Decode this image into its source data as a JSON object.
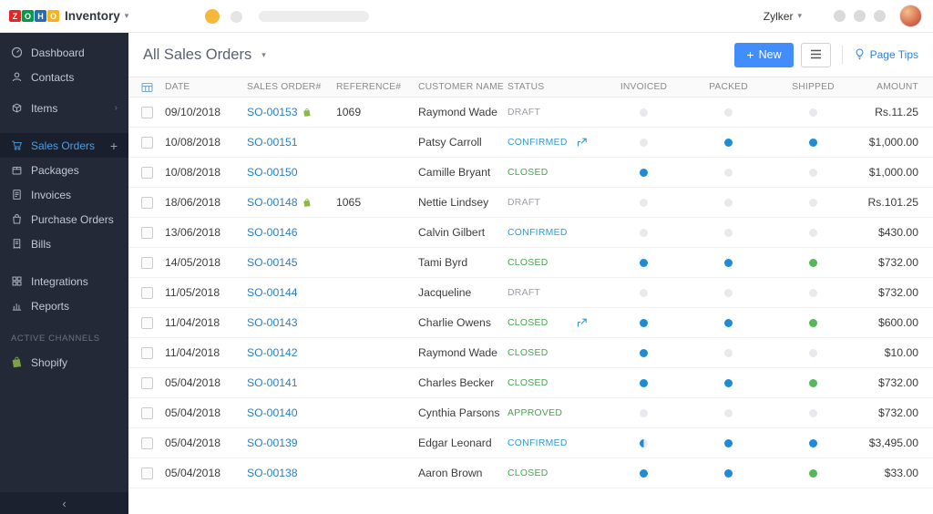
{
  "topbar": {
    "logo_letters": [
      "Z",
      "O",
      "H",
      "O"
    ],
    "product": "Inventory",
    "org_name": "Zylker"
  },
  "sidebar": {
    "items": [
      {
        "label": "Dashboard"
      },
      {
        "label": "Contacts"
      },
      {
        "label": "Items"
      },
      {
        "label": "Sales Orders",
        "active": true
      },
      {
        "label": "Packages"
      },
      {
        "label": "Invoices"
      },
      {
        "label": "Purchase Orders"
      },
      {
        "label": "Bills"
      },
      {
        "label": "Integrations"
      },
      {
        "label": "Reports"
      }
    ],
    "section_label": "ACTIVE CHANNELS",
    "channels": [
      {
        "label": "Shopify"
      }
    ]
  },
  "content": {
    "title": "All Sales Orders",
    "new_button_label": "New",
    "page_tips_label": "Page Tips"
  },
  "table": {
    "columns": [
      "DATE",
      "SALES ORDER#",
      "REFERENCE#",
      "CUSTOMER NAME",
      "STATUS",
      "INVOICED",
      "PACKED",
      "SHIPPED",
      "AMOUNT"
    ],
    "rows": [
      {
        "date": "09/10/2018",
        "order": "SO-00153",
        "shopify": true,
        "reference": "1069",
        "customer": "Raymond Wade",
        "status": "DRAFT",
        "status_type": "draft",
        "linked": false,
        "invoiced": "gray",
        "packed": "gray",
        "shipped": "gray",
        "amount": "Rs.11.25"
      },
      {
        "date": "10/08/2018",
        "order": "SO-00151",
        "shopify": false,
        "reference": "",
        "customer": "Patsy Carroll",
        "status": "CONFIRMED",
        "status_type": "confirmed",
        "linked": true,
        "invoiced": "gray",
        "packed": "blue",
        "shipped": "blue",
        "amount": "$1,000.00"
      },
      {
        "date": "10/08/2018",
        "order": "SO-00150",
        "shopify": false,
        "reference": "",
        "customer": "Camille Bryant",
        "status": "CLOSED",
        "status_type": "closed",
        "linked": false,
        "invoiced": "blue",
        "packed": "gray",
        "shipped": "gray",
        "amount": "$1,000.00"
      },
      {
        "date": "18/06/2018",
        "order": "SO-00148",
        "shopify": true,
        "reference": "1065",
        "customer": "Nettie Lindsey",
        "status": "DRAFT",
        "status_type": "draft",
        "linked": false,
        "invoiced": "gray",
        "packed": "gray",
        "shipped": "gray",
        "amount": "Rs.101.25"
      },
      {
        "date": "13/06/2018",
        "order": "SO-00146",
        "shopify": false,
        "reference": "",
        "customer": "Calvin Gilbert",
        "status": "CONFIRMED",
        "status_type": "confirmed",
        "linked": false,
        "invoiced": "gray",
        "packed": "gray",
        "shipped": "gray",
        "amount": "$430.00"
      },
      {
        "date": "14/05/2018",
        "order": "SO-00145",
        "shopify": false,
        "reference": "",
        "customer": "Tami Byrd",
        "status": "CLOSED",
        "status_type": "closed",
        "linked": false,
        "invoiced": "blue",
        "packed": "blue",
        "shipped": "green",
        "amount": "$732.00"
      },
      {
        "date": "11/05/2018",
        "order": "SO-00144",
        "shopify": false,
        "reference": "",
        "customer": "Jacqueline",
        "status": "DRAFT",
        "status_type": "draft",
        "linked": false,
        "invoiced": "gray",
        "packed": "gray",
        "shipped": "gray",
        "amount": "$732.00"
      },
      {
        "date": "11/04/2018",
        "order": "SO-00143",
        "shopify": false,
        "reference": "",
        "customer": "Charlie Owens",
        "status": "CLOSED",
        "status_type": "closed",
        "linked": true,
        "invoiced": "blue",
        "packed": "blue",
        "shipped": "green",
        "amount": "$600.00"
      },
      {
        "date": "11/04/2018",
        "order": "SO-00142",
        "shopify": false,
        "reference": "",
        "customer": "Raymond Wade",
        "status": "CLOSED",
        "status_type": "closed",
        "linked": false,
        "invoiced": "blue",
        "packed": "gray",
        "shipped": "gray",
        "amount": "$10.00"
      },
      {
        "date": "05/04/2018",
        "order": "SO-00141",
        "shopify": false,
        "reference": "",
        "customer": "Charles Becker",
        "status": "CLOSED",
        "status_type": "closed",
        "linked": false,
        "invoiced": "blue",
        "packed": "blue",
        "shipped": "green",
        "amount": "$732.00"
      },
      {
        "date": "05/04/2018",
        "order": "SO-00140",
        "shopify": false,
        "reference": "",
        "customer": "Cynthia Parsons",
        "status": "APPROVED",
        "status_type": "approved",
        "linked": false,
        "invoiced": "gray",
        "packed": "gray",
        "shipped": "gray",
        "amount": "$732.00"
      },
      {
        "date": "05/04/2018",
        "order": "SO-00139",
        "shopify": false,
        "reference": "",
        "customer": "Edgar Leonard",
        "status": "CONFIRMED",
        "status_type": "confirmed",
        "linked": false,
        "invoiced": "half",
        "packed": "blue",
        "shipped": "blue",
        "amount": "$3,495.00"
      },
      {
        "date": "05/04/2018",
        "order": "SO-00138",
        "shopify": false,
        "reference": "",
        "customer": "Aaron Brown",
        "status": "CLOSED",
        "status_type": "closed",
        "linked": false,
        "invoiced": "blue",
        "packed": "blue",
        "shipped": "green",
        "amount": "$33.00"
      }
    ]
  },
  "colors": {
    "accent_blue": "#408dfb",
    "link_blue": "#2a7fc4",
    "status_gray": "#9a9ea6",
    "status_blue": "#2e9cd4",
    "status_green": "#44a64c",
    "dot_gray": "#e7e9ec",
    "dot_blue": "#1e8bd8",
    "dot_green": "#57b75b",
    "sidebar_bg": "#242938",
    "shopify_green": "#8db843"
  }
}
